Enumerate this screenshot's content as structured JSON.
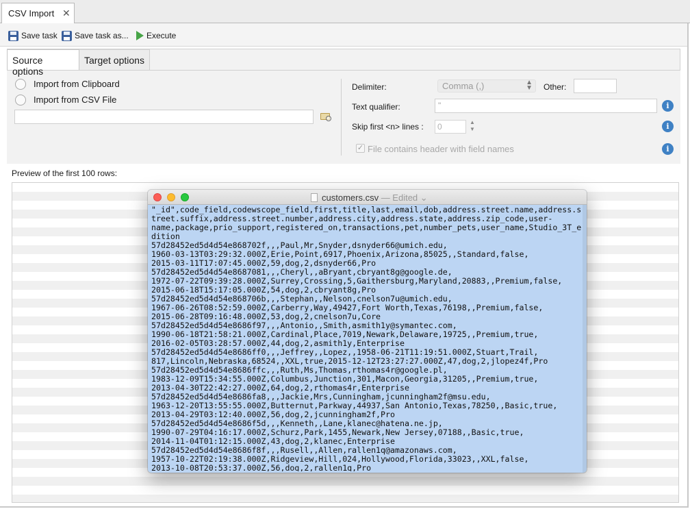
{
  "tab": {
    "label": "CSV Import",
    "close": "✕"
  },
  "toolbar": {
    "save_task": "Save task",
    "save_task_as": "Save task as...",
    "execute": "Execute"
  },
  "subtabs": {
    "source": "Source options",
    "target": "Target options"
  },
  "source": {
    "clipboard": "Import from Clipboard",
    "csv_file": "Import from CSV File",
    "path": ""
  },
  "fields": {
    "delimiter_label": "Delimiter:",
    "delimiter_value": "Comma (,)",
    "other_label": "Other:",
    "other_value": "",
    "qualifier_label": "Text qualifier:",
    "qualifier_value": "\"",
    "skip_label": "Skip first <n> lines :",
    "skip_value": "0",
    "header_label": "File contains header with field names",
    "header_checked": true
  },
  "preview_label": "Preview of the first 100 rows:",
  "mac_window": {
    "filename": "customers.csv",
    "status": " — Edited ⌄",
    "lines": [
      "\"_id\",code_field,codewscope_field,first,title,last,email,dob,address.street.name,address.s",
      "treet.suffix,address.street.number,address.city,address.state,address.zip_code,user-",
      "name,package,prio_support,registered_on,transactions,pet,number_pets,user_name,Studio_3T_e",
      "dition",
      "57d28452ed5d4d54e868702f,,,Paul,Mr,Snyder,dsnyder66@umich.edu,",
      "1960-03-13T03:29:32.000Z,Erie,Point,6917,Phoenix,Arizona,85025,,Standard,false,",
      "2015-03-11T17:07:45.000Z,59,dog,2,dsnyder66,Pro",
      "57d28452ed5d4d54e8687081,,,Cheryl,,aBryant,cbryant8g@google.de,",
      "1972-07-22T09:39:28.000Z,Surrey,Crossing,5,Gaithersburg,Maryland,20883,,Premium,false,",
      "2015-06-18T15:17:05.000Z,54,dog,2,cbryant8g,Pro",
      "57d28452ed5d4d54e868706b,,,Stephan,,Nelson,cnelson7u@umich.edu,",
      "1967-06-26T08:52:59.000Z,Carberry,Way,49427,Fort Worth,Texas,76198,,Premium,false,",
      "2015-06-28T09:16:48.000Z,53,dog,2,cnelson7u,Core",
      "57d28452ed5d4d54e8686f97,,,Antonio,,Smith,asmith1y@symantec.com,",
      "1990-06-18T21:58:21.000Z,Cardinal,Place,7019,Newark,Delaware,19725,,Premium,true,",
      "2016-02-05T03:28:57.000Z,44,dog,2,asmith1y,Enterprise",
      "57d28452ed5d4d54e8686ff0,,,Jeffrey,,Lopez,,1958-06-21T11:19:51.000Z,Stuart,Trail,",
      "817,Lincoln,Nebraska,68524,,XXL,true,2015-12-12T23:27:27.000Z,47,dog,2,jlopez4f,Pro",
      "57d28452ed5d4d54e8686ffc,,,Ruth,Ms,Thomas,rthomas4r@google.pl,",
      "1983-12-09T15:34:55.000Z,Columbus,Junction,301,Macon,Georgia,31205,,Premium,true,",
      "2013-04-30T22:42:27.000Z,64,dog,2,rthomas4r,Enterprise",
      "57d28452ed5d4d54e8686fa8,,,Jackie,Mrs,Cunningham,jcunningham2f@msu.edu,",
      "1963-12-20T13:55:55.000Z,Butternut,Parkway,44937,San Antonio,Texas,78250,,Basic,true,",
      "2013-04-29T03:12:40.000Z,56,dog,2,jcunningham2f,Pro",
      "57d28452ed5d4d54e8686f5d,,,Kenneth,,Lane,klanec@hatena.ne.jp,",
      "1990-07-29T04:16:17.000Z,Schurz,Park,1455,Newark,New Jersey,07188,,Basic,true,",
      "2014-11-04T01:12:15.000Z,43,dog,2,klanec,Enterprise",
      "57d28452ed5d4d54e8686f8f,,,Rusell,,Allen,rallen1q@amazonaws.com,",
      "1957-10-22T02:19:38.000Z,Ridgeview,Hill,024,Hollywood,Florida,33023,,XXL,false,",
      "2013-10-08T20:53:37.000Z,56,dog,2,rallen1q,Pro"
    ]
  },
  "colors": {
    "accent": "#3f81c4",
    "selection": "#bcd5f3",
    "execute": "#47a447"
  }
}
